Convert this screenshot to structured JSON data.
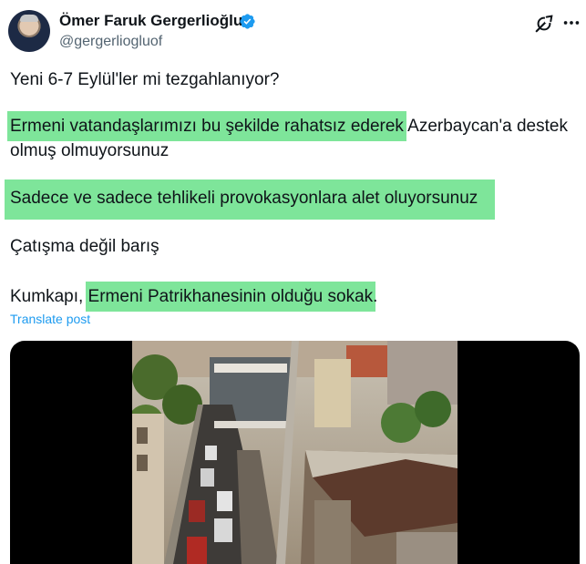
{
  "author": {
    "display_name": "Ömer Faruk Gergerlioğlu",
    "handle": "@gergerliogluof",
    "verified_color": "#1d9bf0"
  },
  "tweet": {
    "line1": "Yeni 6-7 Eylül'ler mi tezgahlanıyor?",
    "line2_highlight": "Ermeni vatandaşlarımızı bu şekilde rahatsız ederek",
    "line2_rest": " Azerbaycan'a destek",
    "line3": "olmuş olmuyorsunuz",
    "line4_highlight": "Sadece ve sadece tehlikeli provokasyonlara alet oluyorsunuz",
    "line5": "Çatışma değil barış",
    "line6_pre": "Kumkapı, ",
    "line6_highlight": "Ermeni Patrikhanesinin olduğu sokak",
    "line6_post": "."
  },
  "translate_label": "Translate post",
  "colors": {
    "highlight": "#7ee59a",
    "link": "#1d9bf0",
    "text": "#0f1419",
    "secondary": "#536471"
  },
  "icons": {
    "verified": "verified-badge-icon",
    "grok": "grok-icon",
    "more": "more-options-icon"
  }
}
